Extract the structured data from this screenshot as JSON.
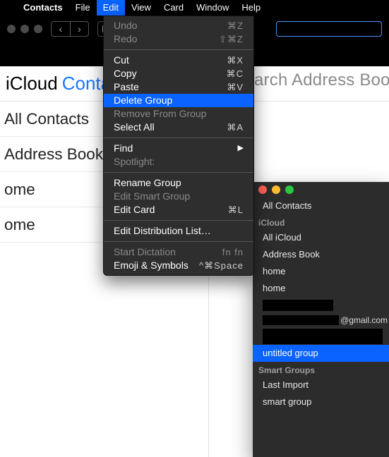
{
  "menubar": {
    "items": [
      "Contacts",
      "File",
      "Edit",
      "View",
      "Card",
      "Window",
      "Help"
    ],
    "open_index": 2
  },
  "strip": {
    "prefix": "iCloud",
    "word": "Conta"
  },
  "big_search_placeholder": "arch Address Book",
  "left_list": [
    "All Contacts",
    "Address Book",
    "ome",
    "ome"
  ],
  "edit_menu": [
    {
      "label": "Undo",
      "shortcut": "⌘Z",
      "disabled": true
    },
    {
      "label": "Redo",
      "shortcut": "⇧⌘Z",
      "disabled": true
    },
    {
      "sep": true
    },
    {
      "label": "Cut",
      "shortcut": "⌘X"
    },
    {
      "label": "Copy",
      "shortcut": "⌘C"
    },
    {
      "label": "Paste",
      "shortcut": "⌘V"
    },
    {
      "label": "Delete Group",
      "highlight": true
    },
    {
      "label": "Remove From Group",
      "disabled": true
    },
    {
      "label": "Select All",
      "shortcut": "⌘A"
    },
    {
      "sep": true
    },
    {
      "label": "Find",
      "submenu": true
    },
    {
      "label": "Spotlight:",
      "disabled": true
    },
    {
      "sep": true
    },
    {
      "label": "Rename Group"
    },
    {
      "label": "Edit Smart Group",
      "disabled": true
    },
    {
      "label": "Edit Card",
      "shortcut": "⌘L"
    },
    {
      "sep": true
    },
    {
      "label": "Edit Distribution List…"
    },
    {
      "sep": true
    },
    {
      "label": "Start Dictation",
      "shortcut": "fn fn",
      "disabled": true
    },
    {
      "label": "Emoji & Symbols",
      "shortcut": "^⌘Space"
    }
  ],
  "panel": {
    "top_item": "All Contacts",
    "sections": [
      {
        "title": "iCloud",
        "items": [
          {
            "label": "All iCloud"
          },
          {
            "label": "Address Book"
          },
          {
            "label": "home"
          },
          {
            "label": "home"
          },
          {
            "redacted": true
          },
          {
            "email_suffix": "@gmail.com",
            "email_redacted": true
          },
          {
            "redacted_full": true
          },
          {
            "label": "untitled group",
            "selected": true
          }
        ]
      },
      {
        "title": "Smart Groups",
        "items": [
          {
            "label": "Last Import"
          },
          {
            "label": "smart group"
          }
        ]
      }
    ]
  }
}
